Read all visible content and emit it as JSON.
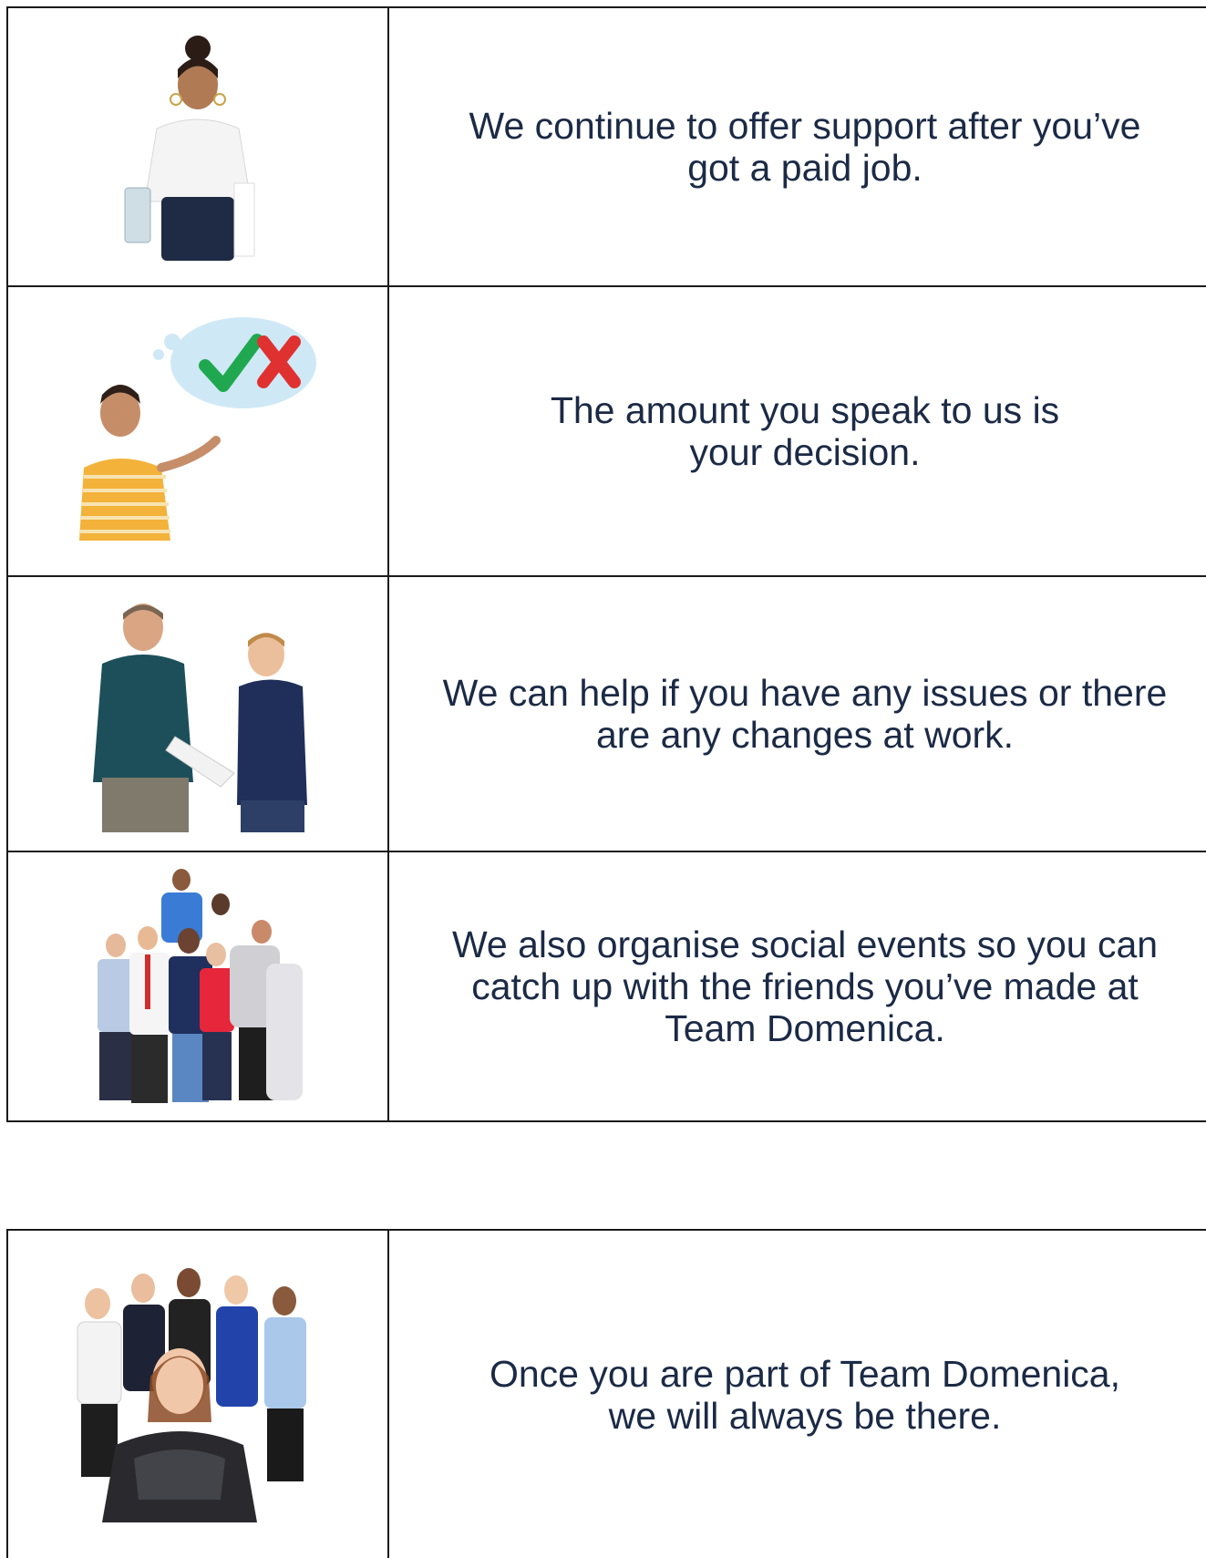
{
  "rows": [
    {
      "image_icon": "waiter-person-icon",
      "text": "We continue to offer support after you’ve\ngot a paid job."
    },
    {
      "image_icon": "thinking-person-decision-icon",
      "text": "The amount you speak to us is\nyour decision."
    },
    {
      "image_icon": "two-people-paper-icon",
      "text": "We can help if you have any issues or there\nare any changes at work."
    },
    {
      "image_icon": "group-of-friends-icon",
      "text": "We also organise social events so you can\ncatch up with the friends you’ve made at\nTeam Domenica."
    }
  ],
  "final_row": {
    "image_icon": "team-staff-group-icon",
    "text": "Once you are part of Team Domenica,\nwe will always be there."
  },
  "colors": {
    "text": "#1b2a45",
    "border": "#1a1a1a",
    "check": "#1fa84f",
    "cross": "#e03131",
    "cloud": "#cfe8f6"
  }
}
